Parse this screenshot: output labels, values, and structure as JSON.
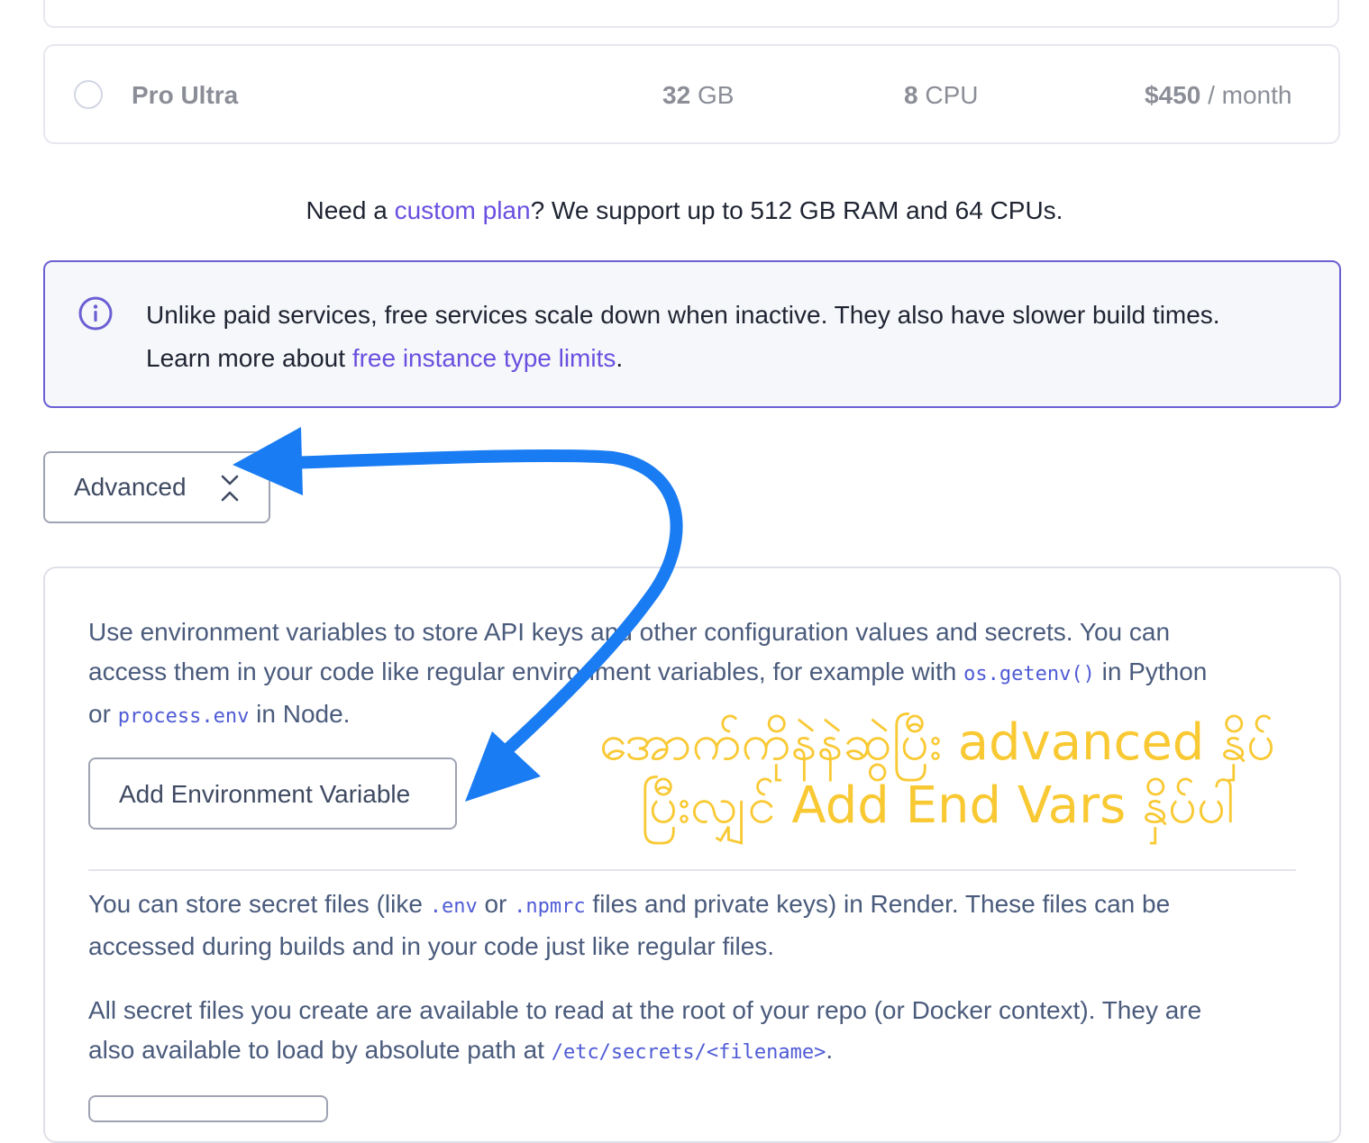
{
  "plan": {
    "name": "Pro Ultra",
    "ram_value": "32",
    "ram_unit": "GB",
    "cpu_value": "8",
    "cpu_unit": "CPU",
    "price": "$450",
    "price_period": "/ month"
  },
  "custom_plan": {
    "prefix": "Need a ",
    "link": "custom plan",
    "suffix": "? We support up to 512 GB RAM and 64 CPUs."
  },
  "info_box": {
    "line1": "Unlike paid services, free services scale down when inactive. They also have slower build times.",
    "line2_prefix": "Learn more about ",
    "line2_link": "free instance type limits",
    "line2_suffix": "."
  },
  "advanced": {
    "label": "Advanced"
  },
  "env_section": {
    "line1": "Use environment variables to store API keys and other configuration values and secrets. You can",
    "line2_prefix": "access them in your code like regular environment variables, for example with ",
    "line2_code": "os.getenv()",
    "line2_suffix": " in Python",
    "line3_prefix": "or ",
    "line3_code": "process.env",
    "line3_suffix": " in Node.",
    "add_button": "Add Environment Variable"
  },
  "secret_files": {
    "p1_line1_a": "You can store secret files (like ",
    "p1_code1": ".env",
    "p1_line1_b": " or ",
    "p1_code2": ".npmrc",
    "p1_line1_c": " files and private keys) in Render. These files can be",
    "p1_line2": "accessed during builds and in your code just like regular files.",
    "p2_line1": "All secret files you create are available to read at the root of your repo (or Docker context). They are",
    "p2_line2_prefix": "also available to load by absolute path at ",
    "p2_code": "/etc/secrets/<filename>",
    "p2_line2_suffix": "."
  },
  "annotation": {
    "line1": "အောက်ကိုနဲနဲဆွဲပြီး advanced နှိပ်",
    "line2": "ပြီးလျှင် Add End Vars နှိပ်ပါ",
    "color": "#f9c934",
    "arrow_color": "#1a7cf2"
  },
  "colors": {
    "link": "#6a4fe0",
    "info_border": "#6b5fd4",
    "body_text": "#4a5b7c"
  }
}
